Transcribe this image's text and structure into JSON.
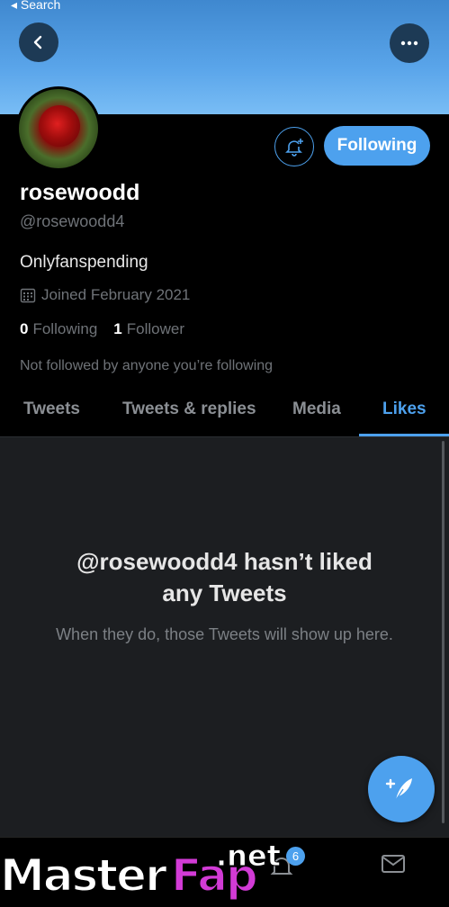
{
  "status": {
    "back_label": "◂ Search"
  },
  "profile": {
    "name": "rosewoodd",
    "handle": "@rosewoodd4",
    "bio": "Onlyfanspending",
    "joined": "Joined February 2021",
    "following_count": "0",
    "following_label": "Following",
    "followers_count": "1",
    "followers_label": "Follower",
    "not_followed": "Not followed by anyone you’re following"
  },
  "actions": {
    "follow_label": "Following"
  },
  "tabs": [
    {
      "label": "Tweets"
    },
    {
      "label": "Tweets & replies"
    },
    {
      "label": "Media"
    },
    {
      "label": "Likes"
    }
  ],
  "empty_state": {
    "title_line1": "@rosewoodd4 hasn’t liked",
    "title_line2": "any Tweets",
    "subtitle": "When they do, those Tweets will show up here."
  },
  "nav": {
    "notification_badge": "6"
  },
  "watermark": {
    "part1": "Master",
    "part2": "Fap",
    "part3": ".net"
  },
  "colors": {
    "accent": "#4da1ee",
    "background": "#000000",
    "panel": "#1c1e21"
  }
}
